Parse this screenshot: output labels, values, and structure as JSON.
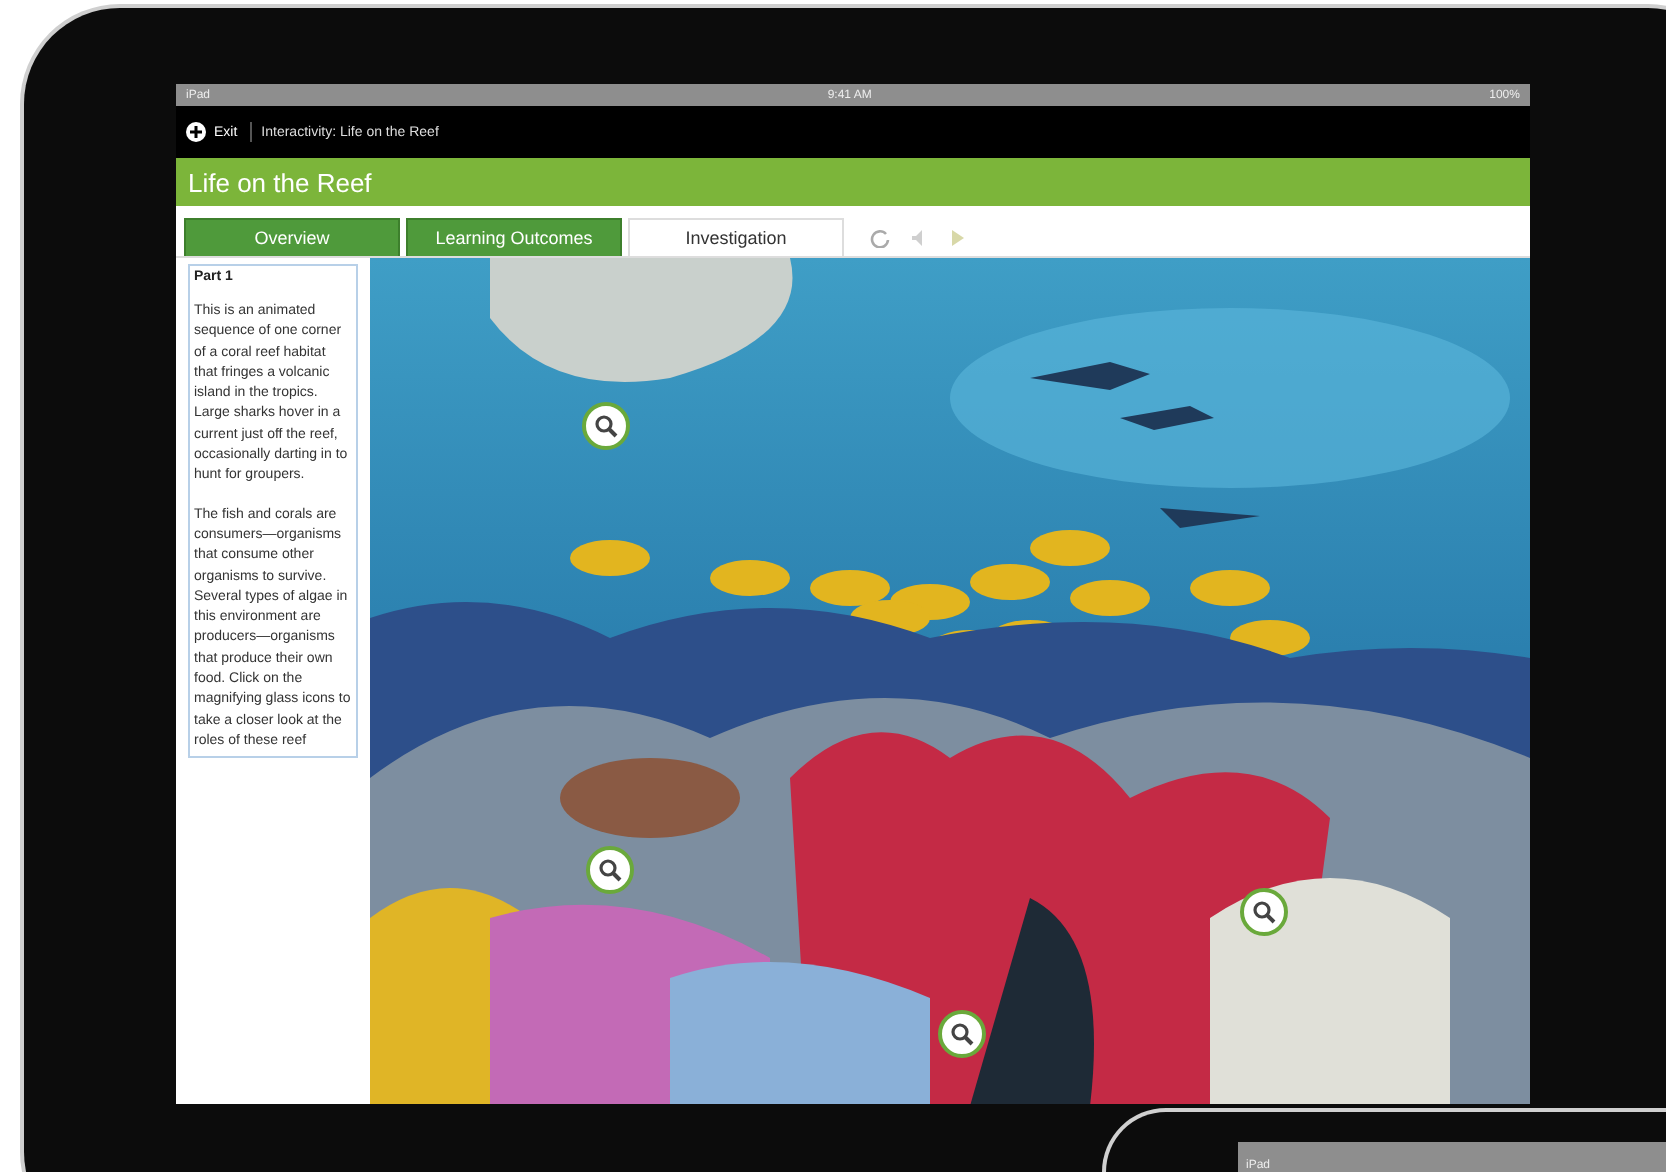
{
  "status_bar": {
    "carrier": "iPad",
    "time": "9:41 AM",
    "battery": "100%"
  },
  "nav_bar": {
    "back": "Exit",
    "title": "Interactivity: Life on the Reef"
  },
  "title": "Life on the Reef",
  "tabs": [
    {
      "label": "Overview",
      "selected": false
    },
    {
      "label": "Learning Outcomes",
      "selected": false
    },
    {
      "label": "Investigation",
      "selected": true
    }
  ],
  "sidebar": {
    "heading": "Part 1",
    "paragraphs": [
      "This is an animated sequence of one corner of a coral reef habitat that fringes a volcanic island in the tropics. Large sharks hover in a current just off the reef, occasionally darting in to hunt for groupers.",
      "The fish and corals are consumers—organisms that consume other organisms to survive. Several types of algae in this environment are producers—organisms that produce their own food. Click on the magnifying glass icons to take a closer look at the roles of these reef"
    ]
  },
  "second_device": {
    "carrier": "iPad"
  }
}
